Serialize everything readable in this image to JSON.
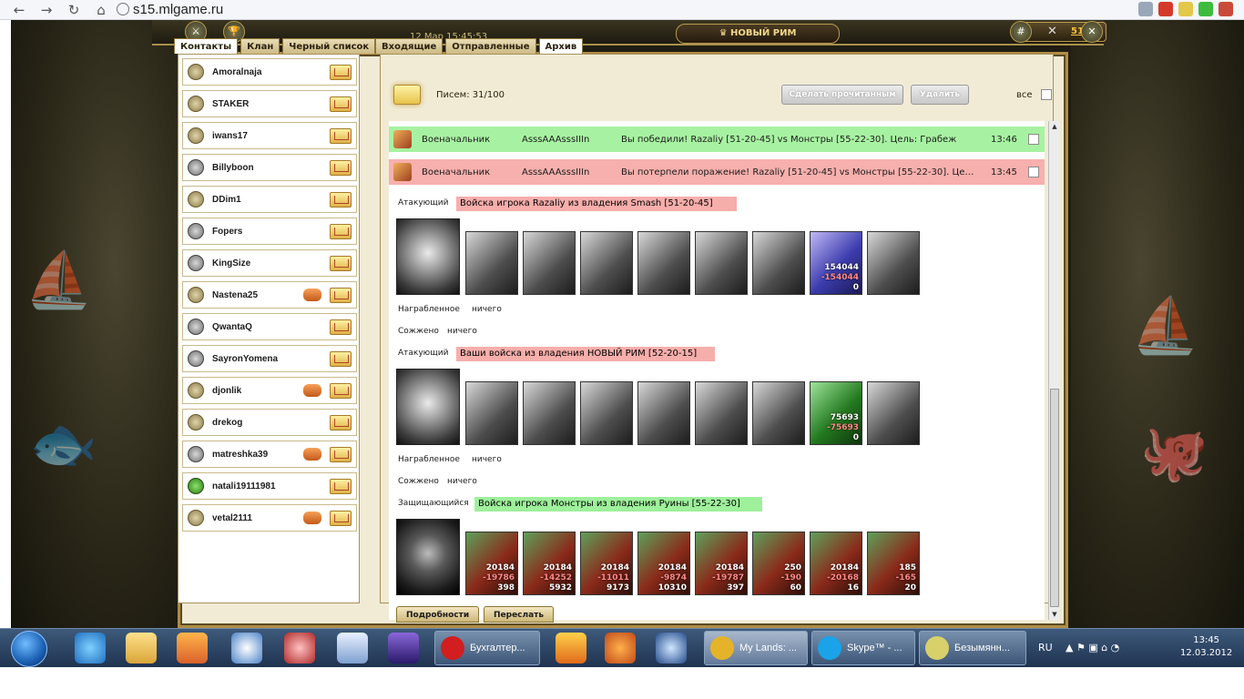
{
  "browser": {
    "url": "s15.mlgame.ru"
  },
  "game": {
    "datetime": "12 Мар 15:45:53",
    "city": "НОВЫЙ РИМ",
    "resource_value": "511",
    "hash_button": "#"
  },
  "left_tabs": [
    "Контакты",
    "Клан",
    "Черный список"
  ],
  "right_tabs": [
    "Входящие",
    "Отправленные",
    "Архив"
  ],
  "contacts": [
    {
      "name": "Amoralnaja",
      "avatar": "gold",
      "handshake": false
    },
    {
      "name": "STAKER",
      "avatar": "gold",
      "handshake": false
    },
    {
      "name": "iwans17",
      "avatar": "gold",
      "handshake": false
    },
    {
      "name": "Billyboon",
      "avatar": "lock",
      "handshake": false
    },
    {
      "name": "DDim1",
      "avatar": "gold",
      "handshake": false
    },
    {
      "name": "Fopers",
      "avatar": "lock",
      "handshake": false
    },
    {
      "name": "KingSize",
      "avatar": "lock",
      "handshake": false
    },
    {
      "name": "Nastena25",
      "avatar": "gold",
      "handshake": true
    },
    {
      "name": "QwantaQ",
      "avatar": "lock",
      "handshake": false
    },
    {
      "name": "SayronYomena",
      "avatar": "lock",
      "handshake": false
    },
    {
      "name": "djonlik",
      "avatar": "gold",
      "handshake": true
    },
    {
      "name": "drekog",
      "avatar": "gold",
      "handshake": false
    },
    {
      "name": "matreshka39",
      "avatar": "lock",
      "handshake": true
    },
    {
      "name": "natali19111981",
      "avatar": "green",
      "handshake": false
    },
    {
      "name": "vetal2111",
      "avatar": "gold",
      "handshake": true
    }
  ],
  "mailbox": {
    "count_label": "Писем: 31/100",
    "mark_read": "Сделать прочитанным",
    "delete": "Удалить",
    "all": "все"
  },
  "messages": [
    {
      "from": "Военачальник",
      "to": "AsssAAAsssIIIn",
      "subject": "Вы победили! Razaliy [51-20-45] vs Монстры [55-22-30]. Цель: Грабеж",
      "time": "13:46",
      "status": "win"
    },
    {
      "from": "Военачальник",
      "to": "AsssAAAsssIIIn",
      "subject": "Вы потерпели поражение! Razaliy [51-20-45] vs Монстры [55-22-30]. Цель: Г...",
      "time": "13:45",
      "status": "lose"
    }
  ],
  "report": {
    "attacker1": {
      "role": "Атакующий",
      "band": "Войска игрока Razaliy из владения Smash [51-20-45]",
      "units": [
        {
          "a": "",
          "b": "",
          "c": ""
        },
        {
          "a": "",
          "b": "",
          "c": ""
        },
        {
          "a": "",
          "b": "",
          "c": ""
        },
        {
          "a": "",
          "b": "",
          "c": ""
        },
        {
          "a": "",
          "b": "",
          "c": ""
        },
        {
          "a": "",
          "b": "",
          "c": ""
        },
        {
          "a": "154044",
          "b": "-154044",
          "c": "0"
        },
        {
          "a": "",
          "b": "",
          "c": ""
        }
      ],
      "looted_label": "Награбленное",
      "looted_value": "ничего",
      "burned_label": "Сожжено",
      "burned_value": "ничего"
    },
    "attacker2": {
      "role": "Атакующий",
      "band": "Ваши войска из владения НОВЫЙ РИМ [52-20-15]",
      "units": [
        {
          "a": "",
          "b": "",
          "c": ""
        },
        {
          "a": "",
          "b": "",
          "c": ""
        },
        {
          "a": "",
          "b": "",
          "c": ""
        },
        {
          "a": "",
          "b": "",
          "c": ""
        },
        {
          "a": "",
          "b": "",
          "c": ""
        },
        {
          "a": "",
          "b": "",
          "c": ""
        },
        {
          "a": "75693",
          "b": "-75693",
          "c": "0"
        },
        {
          "a": "",
          "b": "",
          "c": ""
        }
      ],
      "looted_label": "Награбленное",
      "looted_value": "ничего",
      "burned_label": "Сожжено",
      "burned_value": "ничего"
    },
    "defender": {
      "role": "Защищающийся",
      "band": "Войска игрока Монстры из владения Руины [55-22-30]",
      "units": [
        {
          "a": "20184",
          "b": "-19786",
          "c": "398"
        },
        {
          "a": "20184",
          "b": "-14252",
          "c": "5932"
        },
        {
          "a": "20184",
          "b": "-11011",
          "c": "9173"
        },
        {
          "a": "20184",
          "b": "-9874",
          "c": "10310"
        },
        {
          "a": "20184",
          "b": "-19787",
          "c": "397"
        },
        {
          "a": "250",
          "b": "-190",
          "c": "60"
        },
        {
          "a": "20184",
          "b": "-20168",
          "c": "16"
        },
        {
          "a": "185",
          "b": "-165",
          "c": "20"
        }
      ]
    }
  },
  "bottom_buttons": {
    "details": "Подробности",
    "forward": "Переслать"
  },
  "taskbar": {
    "apps": [
      {
        "label": "Бухгалтер...",
        "color": "#d21e1e"
      },
      {
        "label": "My Lands: ...",
        "color": "#e5b32a"
      },
      {
        "label": "Skype™ - ...",
        "color": "#1aa3e8"
      },
      {
        "label": "Безымянн...",
        "color": "#d8d06a"
      }
    ],
    "lang": "RU",
    "time": "13:45",
    "date": "12.03.2012"
  }
}
